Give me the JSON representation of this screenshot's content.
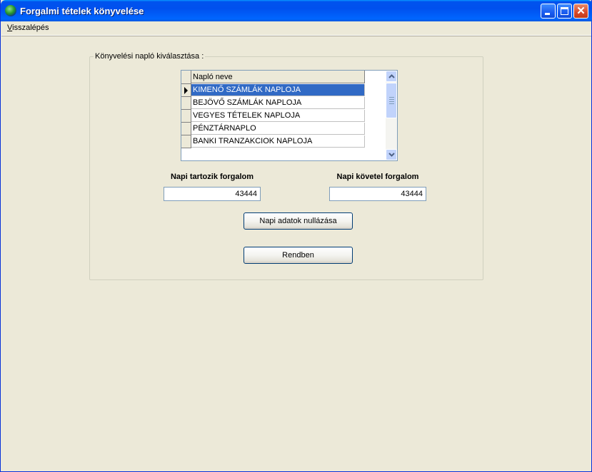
{
  "window": {
    "title": "Forgalmi tételek könyvelése"
  },
  "menu": [
    {
      "first": "V",
      "rest": "isszalépés"
    }
  ],
  "group": {
    "legend": "Könyvelési napló kiválasztása :"
  },
  "grid": {
    "column_header": "Napló neve",
    "rows": [
      "KIMENŐ SZÁMLÁK NAPLOJA",
      "BEJÖVŐ SZÁMLÁK NAPLOJA",
      "VEGYES TÉTELEK NAPLOJA",
      "PÉNZTÁRNAPLO",
      "BANKI TRANZAKCIOK NAPLOJA"
    ],
    "selected_index": 0
  },
  "fields": {
    "debit": {
      "label": "Napi tartozik forgalom",
      "value": "43444"
    },
    "credit": {
      "label": "Napi követel forgalom",
      "value": "43444"
    }
  },
  "buttons": {
    "reset": "Napi adatok nullázása",
    "ok": "Rendben"
  },
  "colors": {
    "titlebar": "#0054E3",
    "selection": "#316AC5",
    "background": "#ECE9D8"
  }
}
